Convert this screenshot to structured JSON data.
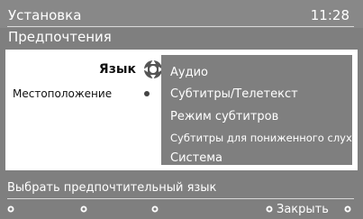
{
  "header": {
    "title": "Установка",
    "time": "11:28"
  },
  "subtitle": "Предпочтения",
  "left_menu": {
    "selected_label": "Язык",
    "location_label": "Местоположение"
  },
  "right_menu": {
    "items": [
      "Аудио",
      "Субтитры/Телетекст",
      "Режим субтитров",
      "Субтитры для пониженного слуха",
      "Система"
    ]
  },
  "footer": {
    "hint": "Выбрать предпочтительный язык",
    "close_label": "Закрыть"
  }
}
